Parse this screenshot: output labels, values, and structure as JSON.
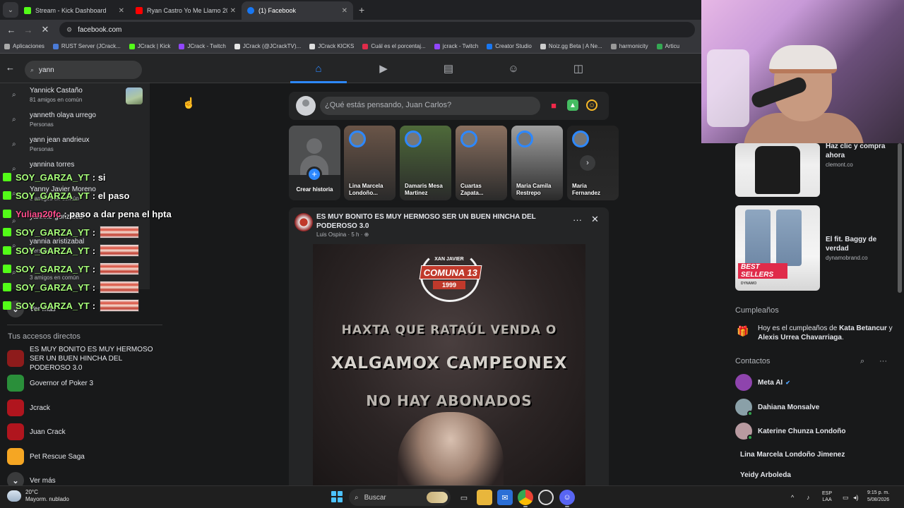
{
  "browser": {
    "tabs": [
      {
        "label": "Stream - Kick Dashboard",
        "color": "#53fc18"
      },
      {
        "label": "Ryan Castro Yo Me Llamo 2026",
        "color": "#ff0000"
      },
      {
        "label": "(1) Facebook",
        "color": "#1877f2"
      }
    ],
    "url": "facebook.com",
    "bookmarks": [
      {
        "label": "Aplicaciones",
        "color": "#aaaaaa"
      },
      {
        "label": "RUST Server (JCrack...",
        "color": "#4a7bd8"
      },
      {
        "label": "JCrack | Kick",
        "color": "#53fc18"
      },
      {
        "label": "JCrack - Twitch",
        "color": "#9146ff"
      },
      {
        "label": "JCrack (@JCrackTV)...",
        "color": "#e6e6e6"
      },
      {
        "label": "JCrack KICKS",
        "color": "#dddddd"
      },
      {
        "label": "Cuál es el porcentaj...",
        "color": "#e02b4a"
      },
      {
        "label": "jcrack - Twitch",
        "color": "#9146ff"
      },
      {
        "label": "Creator Studio",
        "color": "#1877f2"
      },
      {
        "label": "Noiz.gg Beta | A Ne...",
        "color": "#cccccc"
      },
      {
        "label": "harmonicity",
        "color": "#999999"
      },
      {
        "label": "Articu",
        "color": "#34a853"
      }
    ]
  },
  "fb": {
    "search_value": "yann",
    "nav": [
      "home-icon",
      "video-icon",
      "marketplace-icon",
      "groups-icon",
      "gaming-icon"
    ],
    "results": [
      {
        "name": "Yannick Castaño",
        "sub": "81 amigos en común"
      },
      {
        "name": "yanneth olaya urrego",
        "sub": "Personas"
      },
      {
        "name": "yann jean andrieux",
        "sub": "Personas"
      },
      {
        "name": "yannina torres",
        "sub": ""
      },
      {
        "name": "Yanny Javier Moreno",
        "sub": "3 amigos en común"
      },
      {
        "name": "yannko gonzález",
        "sub": ""
      },
      {
        "name": "yannia aristizabal",
        "sub": "Personas"
      },
      {
        "name": "",
        "sub": "3 amigos en común"
      }
    ],
    "see_more_top": "Ver más",
    "shortcuts_title": "Tus accesos directos",
    "shortcuts": [
      {
        "label": "ES MUY BONITO ES MUY HERMOSO SER UN BUEN HINCHA DEL PODEROSO 3.0",
        "color": "#8e1b1b"
      },
      {
        "label": "Governor of Poker 3",
        "color": "#2a8f3a"
      },
      {
        "label": "Jcrack",
        "color": "#b0151e"
      },
      {
        "label": "Juan Crack",
        "color": "#b0151e"
      },
      {
        "label": "Pet Rescue Saga",
        "color": "#f5a623"
      }
    ],
    "see_more_bottom": "Ver más",
    "composer_placeholder": "¿Qué estás pensando, Juan Carlos?",
    "create_story": "Crear historia",
    "stories": [
      {
        "name": "Lina Marcela Londoño...",
        "color": "#6a5548"
      },
      {
        "name": "Damaris Mesa Martinez",
        "color": "#4e6a3a"
      },
      {
        "name": "Cuartas Zapata...",
        "color": "#8a7060"
      },
      {
        "name": "Maria Camila Restrepo",
        "color": "#a0a0a0"
      },
      {
        "name": "Maria Fernandez",
        "color": "#222222"
      }
    ],
    "post": {
      "title": "ES MUY BONITO ES MUY HERMOSO SER UN BUEN HINCHA DEL PODEROSO 3.0",
      "author": "Luis Ospina",
      "time": "5 h",
      "image_text": {
        "small": "XAN JAVIER",
        "logo": "COMUNA 13",
        "year": "1999",
        "line1": "HAXTA QUE RATAÚL VENDA O",
        "line2": "XALGAMOX CAMPEONEX",
        "line3": "NO HAY ABONADOS"
      }
    }
  },
  "chat": [
    {
      "user": "SOY_GARZA_YT",
      "msg": ": si",
      "emote": false
    },
    {
      "user": "SOY_GARZA_YT",
      "msg": ": el paso",
      "emote": false
    },
    {
      "user": "Yulian20fc",
      "msg": ": paso a dar pena el hpta",
      "emote": false
    },
    {
      "user": "SOY_GARZA_YT",
      "msg": ":",
      "emote": true
    },
    {
      "user": "SOY_GARZA_YT",
      "msg": ":",
      "emote": true
    },
    {
      "user": "SOY_GARZA_YT",
      "msg": ":",
      "emote": true
    },
    {
      "user": "SOY_GARZA_YT",
      "msg": ":",
      "emote": true
    },
    {
      "user": "SOY_GARZA_YT",
      "msg": ":",
      "emote": true
    }
  ],
  "right": {
    "ads": [
      {
        "title": "Haz clic y compra ahora",
        "domain": "clemont.co"
      },
      {
        "title": "El fit. Baggy de verdad",
        "domain": "dynamobrand.co",
        "banner": "BEST SELLERS",
        "brand": "DYNAMO"
      }
    ],
    "birthdays_title": "Cumpleaños",
    "birthday_prefix": "Hoy es el cumpleaños de ",
    "birthday_name1": "Kata Betancur",
    "birthday_join": " y ",
    "birthday_name2": "Alexis Urrea Chavarriaga",
    "birthday_end": ".",
    "contacts_title": "Contactos",
    "contacts": [
      {
        "name": "Meta AI",
        "color": "#8e44ad",
        "online": false,
        "verified": true
      },
      {
        "name": "Dahiana Monsalve",
        "color": "#8aa0a8",
        "online": true,
        "verified": false
      },
      {
        "name": "Katerine Chunza Londoño",
        "color": "#b89aa0",
        "online": true,
        "verified": false
      },
      {
        "name": "Lina Marcela Londoño Jimenez",
        "color": "",
        "online": false,
        "verified": false
      },
      {
        "name": "Yeidy Arboleda",
        "color": "",
        "online": false,
        "verified": false
      }
    ]
  },
  "taskbar": {
    "temp": "20°C",
    "weather": "Mayorm. nublado",
    "search": "Buscar",
    "lang1": "ESP",
    "lang2": "LAA",
    "time": "9:15 p. m.",
    "date": "5/08/2026"
  }
}
